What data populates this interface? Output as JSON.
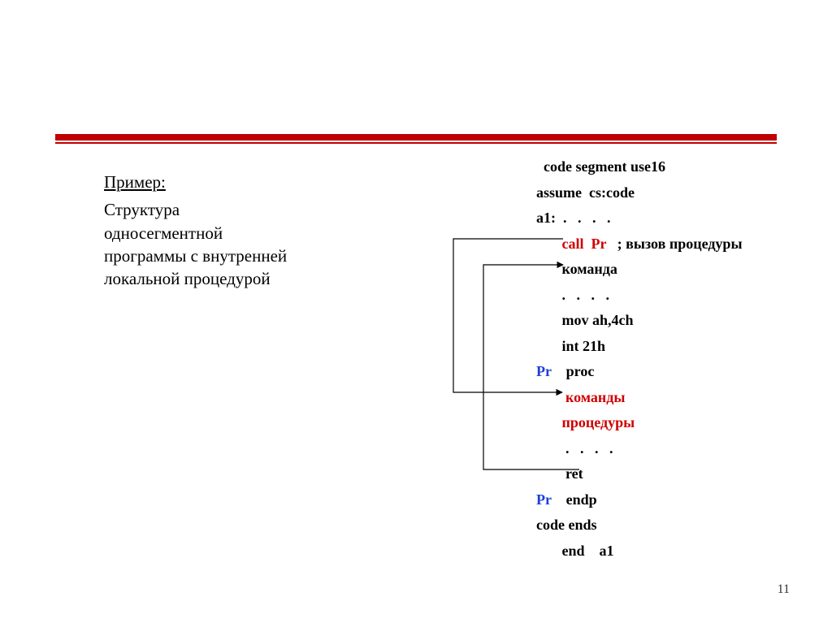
{
  "page_number": "11",
  "left": {
    "example": "Пример:",
    "desc_l1": "Структура",
    "desc_l2": "односегментной",
    "desc_l3": "программы с внутренней",
    "desc_l4": "локальной процедурой"
  },
  "code": {
    "l1": "  code segment use16",
    "l2": "assume  cs:code",
    "l3": "a1:  .   .   .   .",
    "l4a": "       ",
    "l4b": "call  Pr",
    "l4c": "   ; вызов процедуры",
    "l5": "       команда",
    "l6": "       .   .   .   .",
    "l7": "       mov ah,4ch",
    "l8": "       int 21h",
    "l9a": "Pr",
    "l9b": "    proc",
    "l10": "        команды",
    "l11": "       процедуры",
    "l12": "        .   .   .   .",
    "l13": "        ret",
    "l14a": "Pr",
    "l14b": "    endp",
    "l15": "code ends",
    "l16": "       end    a1"
  }
}
